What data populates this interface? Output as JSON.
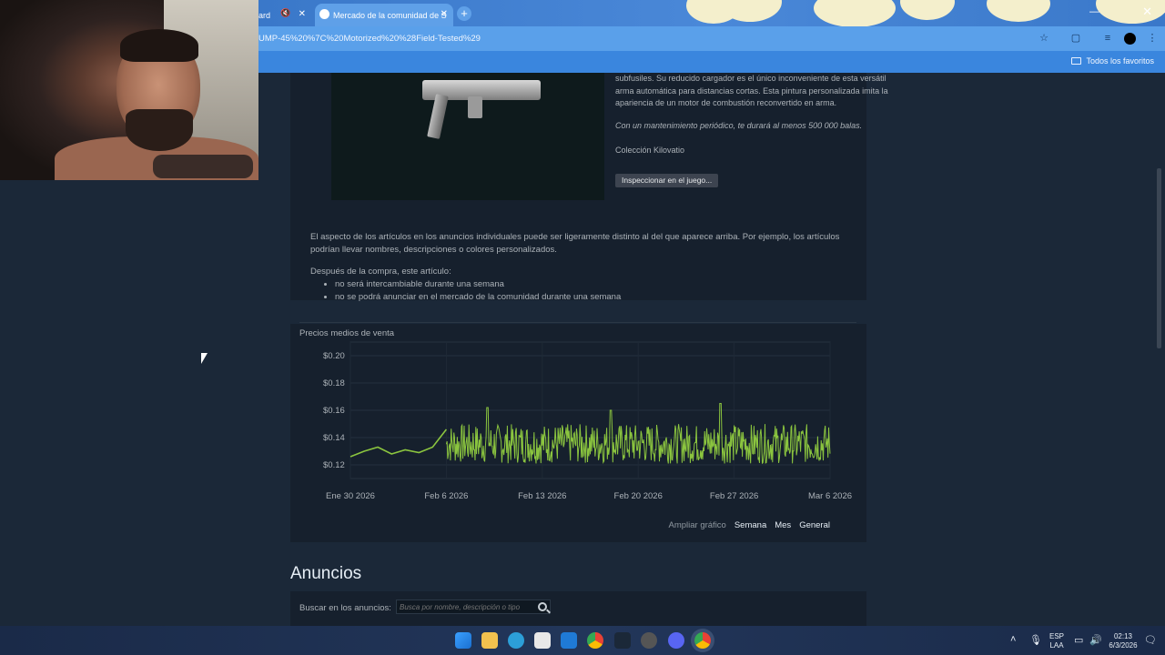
{
  "browser": {
    "prev_tab_label": "ard",
    "active_tab_label": "Mercado de la comunidad de S",
    "url": "UMP-45%20%7C%20Motorized%20%28Field-Tested%29",
    "new_tab_symbol": "+",
    "close_symbol": "✕",
    "bookmarks_folder": "Todos los favoritos"
  },
  "item": {
    "description": "subfusiles. Su reducido cargador es el único inconveniente de esta versátil arma automática para distancias cortas. Esta pintura personalizada imita la apariencia de un motor de combustión reconvertido en arma.",
    "quote": "Con un mantenimiento periódico, te durará al menos 500 000 balas.",
    "collection": "Colección Kilovatio",
    "inspect_button": "Inspeccionar en el juego..."
  },
  "notes": {
    "appearance": "El aspecto de los artículos en los anuncios individuales puede ser ligeramente distinto al del que aparece arriba. Por ejemplo, los artículos podrían llevar nombres, descripciones o colores personalizados.",
    "after_purchase": "Después de la compra, este artículo:",
    "restrictions": [
      "no será intercambiable durante una semana",
      "no se podrá anunciar en el mercado de la comunidad durante una semana"
    ]
  },
  "chart_data": {
    "type": "line",
    "title": "Precios medios de venta",
    "x_ticks": [
      "Ene 30 2026",
      "Feb 6 2026",
      "Feb 13 2026",
      "Feb 20 2026",
      "Feb 27 2026",
      "Mar 6 2026"
    ],
    "y_ticks": [
      "$0.20",
      "$0.18",
      "$0.16",
      "$0.14",
      "$0.12"
    ],
    "ylim": [
      0.11,
      0.21
    ],
    "xlim": [
      "2026-01-30",
      "2026-03-06"
    ],
    "daily_series": [
      {
        "x": "2026-01-30",
        "y": 0.126
      },
      {
        "x": "2026-01-31",
        "y": 0.13
      },
      {
        "x": "2026-02-01",
        "y": 0.133
      },
      {
        "x": "2026-02-02",
        "y": 0.128
      },
      {
        "x": "2026-02-03",
        "y": 0.131
      },
      {
        "x": "2026-02-04",
        "y": 0.129
      },
      {
        "x": "2026-02-05",
        "y": 0.133
      },
      {
        "x": "2026-02-06",
        "y": 0.146
      }
    ],
    "hourly_band": {
      "from": "2026-02-06",
      "to": "2026-03-06",
      "low": 0.121,
      "high": 0.15,
      "peaks": [
        {
          "x": "2026-02-09",
          "y": 0.162
        },
        {
          "x": "2026-02-18",
          "y": 0.16
        },
        {
          "x": "2026-02-26",
          "y": 0.165
        }
      ]
    },
    "series_color": "#8bc53f",
    "grid": true
  },
  "chart_controls": {
    "zoom_label": "Ampliar gráfico",
    "week": "Semana",
    "month": "Mes",
    "general": "General"
  },
  "listings": {
    "heading": "Anuncios",
    "search_label": "Buscar en los anuncios:",
    "search_placeholder": "Busca por nombre, descripción o tipo"
  },
  "taskbar": {
    "lang_1": "ESP",
    "lang_2": "LAA",
    "time": "02:13",
    "date": "6/3/2026"
  }
}
